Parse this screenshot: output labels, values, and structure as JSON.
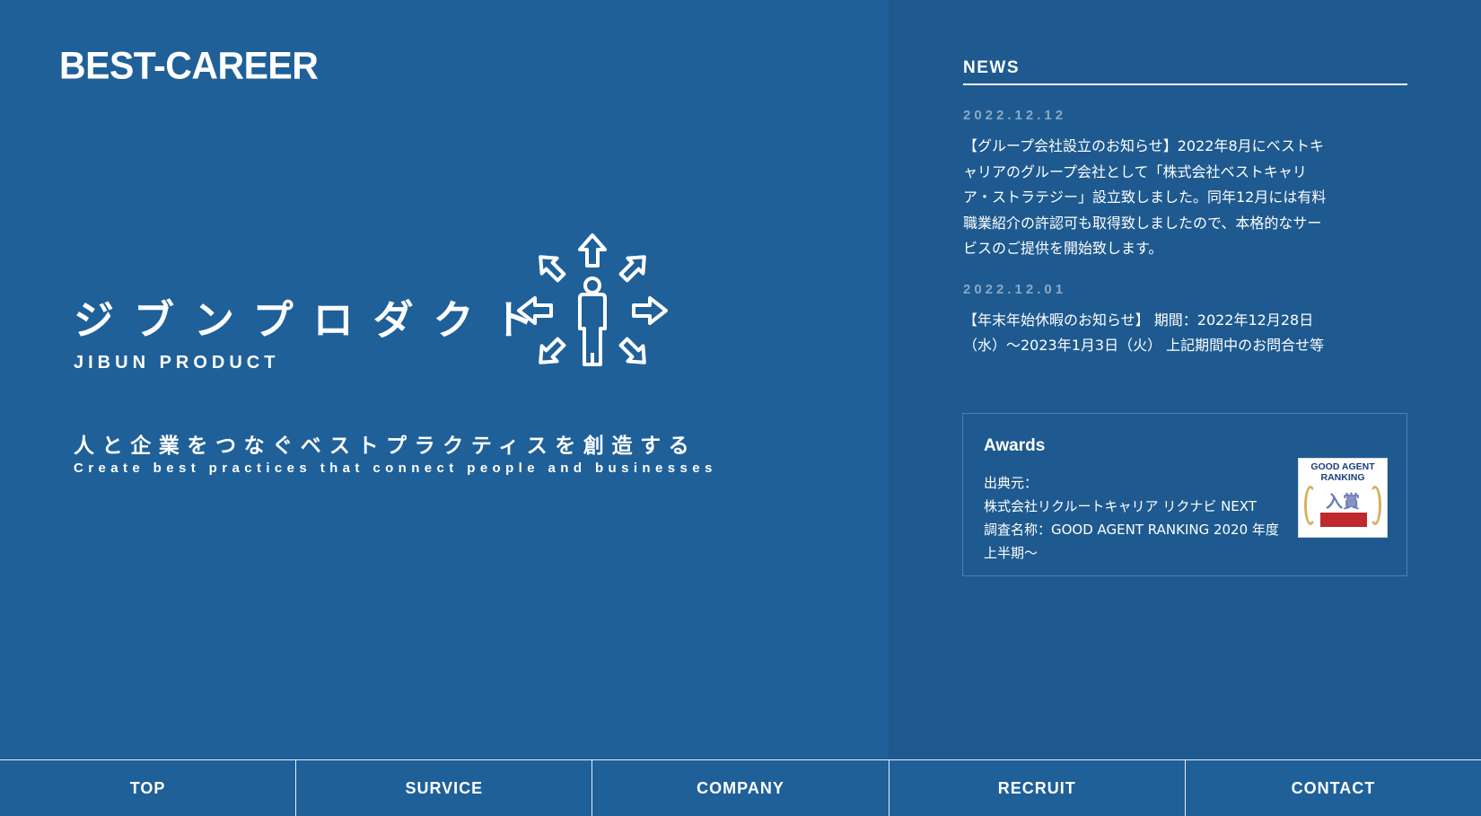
{
  "brand": {
    "logo": "BEST-CAREER"
  },
  "hero": {
    "product_jp": "ジブンプロダクト",
    "product_en": "JIBUN PRODUCT",
    "product_icon": "person-arrows-outward-icon",
    "tagline_jp": "人と企業をつなぐベストプラクティスを創造する",
    "tagline_en": "Create best practices that connect people and businesses"
  },
  "news": {
    "title": "NEWS",
    "items": [
      {
        "date": "2022.12.12",
        "lines": [
          "【グループ会社設立のお知らせ】2022年8月にベストキ",
          "ャリアのグループ会社として「株式会社ベストキャリ",
          "ア・ストラテジー」設立致しました。同年12月には有料",
          "職業紹介の許認可も取得致しましたので、本格的なサー",
          "ビスのご提供を開始致します。"
        ]
      },
      {
        "date": "2022.12.01",
        "lines": [
          "【年末年始休暇のお知らせ】 期間：2022年12月28日",
          "（水）〜2023年1月3日（火） 上記期間中のお問合せ等"
        ]
      }
    ]
  },
  "awards": {
    "title": "Awards",
    "lines": [
      "出典元：",
      "株式会社リクルートキャリア リクナビ NEXT",
      "調査名称：GOOD AGENT RANKING 2020 年度",
      "上半期〜"
    ],
    "badge": {
      "line1": "GOOD AGENT",
      "line2": "RANKING",
      "kanji": "入賞"
    }
  },
  "nav": {
    "items": [
      "TOP",
      "SURVICE",
      "COMPANY",
      "RECRUIT",
      "CONTACT"
    ]
  }
}
